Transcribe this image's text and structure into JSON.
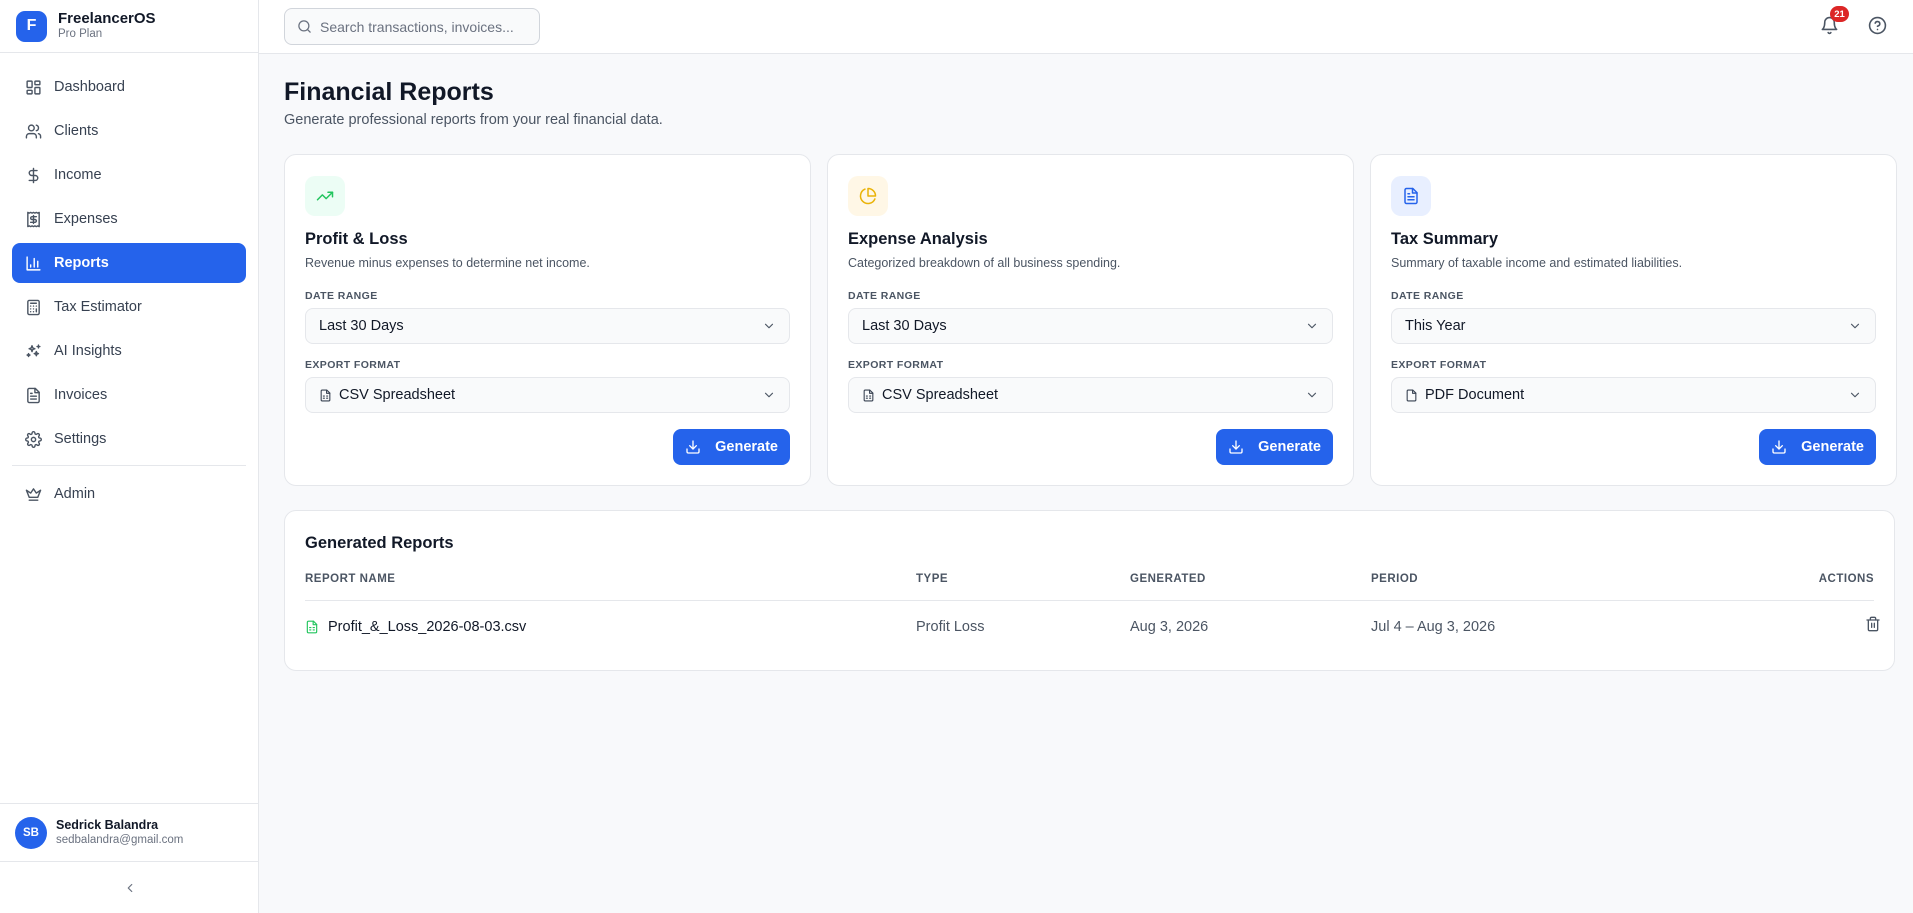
{
  "app": {
    "logo_letter": "F",
    "name": "FreelancerOS",
    "plan": "Pro Plan"
  },
  "sidebar": {
    "items": [
      {
        "label": "Dashboard",
        "icon": "dashboard-icon"
      },
      {
        "label": "Clients",
        "icon": "users-icon"
      },
      {
        "label": "Income",
        "icon": "dollar-icon"
      },
      {
        "label": "Expenses",
        "icon": "receipt-icon"
      },
      {
        "label": "Reports",
        "icon": "bar-chart-icon",
        "active": true
      },
      {
        "label": "Tax Estimator",
        "icon": "calculator-icon"
      },
      {
        "label": "AI Insights",
        "icon": "sparkles-icon"
      },
      {
        "label": "Invoices",
        "icon": "file-text-icon"
      },
      {
        "label": "Settings",
        "icon": "gear-icon"
      }
    ],
    "admin": {
      "label": "Admin",
      "icon": "crown-icon"
    },
    "accent": "#2563eb"
  },
  "user": {
    "initials": "SB",
    "name": "Sedrick Balandra",
    "email": "sedbalandra@gmail.com"
  },
  "topbar": {
    "search_placeholder": "Search transactions, invoices...",
    "notifications": "21"
  },
  "page": {
    "title": "Financial Reports",
    "subtitle": "Generate professional reports from your real financial data."
  },
  "cards": [
    {
      "title": "Profit & Loss",
      "desc": "Revenue minus expenses to determine net income.",
      "icon": "trending-up-icon",
      "date_label": "DATE RANGE",
      "date_value": "Last 30 Days",
      "format_label": "EXPORT FORMAT",
      "format_value": "CSV Spreadsheet",
      "button": "Generate"
    },
    {
      "title": "Expense Analysis",
      "desc": "Categorized breakdown of all business spending.",
      "icon": "pie-chart-icon",
      "date_label": "DATE RANGE",
      "date_value": "Last 30 Days",
      "format_label": "EXPORT FORMAT",
      "format_value": "CSV Spreadsheet",
      "button": "Generate"
    },
    {
      "title": "Tax Summary",
      "desc": "Summary of taxable income and estimated liabilities.",
      "icon": "document-icon",
      "date_label": "DATE RANGE",
      "date_value": "This Year",
      "format_label": "EXPORT FORMAT",
      "format_value": "PDF Document",
      "button": "Generate"
    }
  ],
  "reports": {
    "title": "Generated Reports",
    "columns": [
      "REPORT NAME",
      "TYPE",
      "GENERATED",
      "PERIOD",
      "ACTIONS"
    ],
    "rows": [
      {
        "name": "Profit_&_Loss_2026-08-03.csv",
        "type": "Profit Loss",
        "generated": "Aug 3, 2026",
        "period": "Jul 4 – Aug 3, 2026"
      }
    ]
  },
  "colors": {
    "primary": "#2563eb",
    "profit_icon_bg": "#ecfdf5",
    "profit_icon": "#22c55e",
    "expense_icon_bg": "#fff7e6",
    "expense_icon": "#eab308",
    "tax_icon_bg": "#e8efff",
    "tax_icon": "#2563eb",
    "badge": "#dc2626"
  }
}
